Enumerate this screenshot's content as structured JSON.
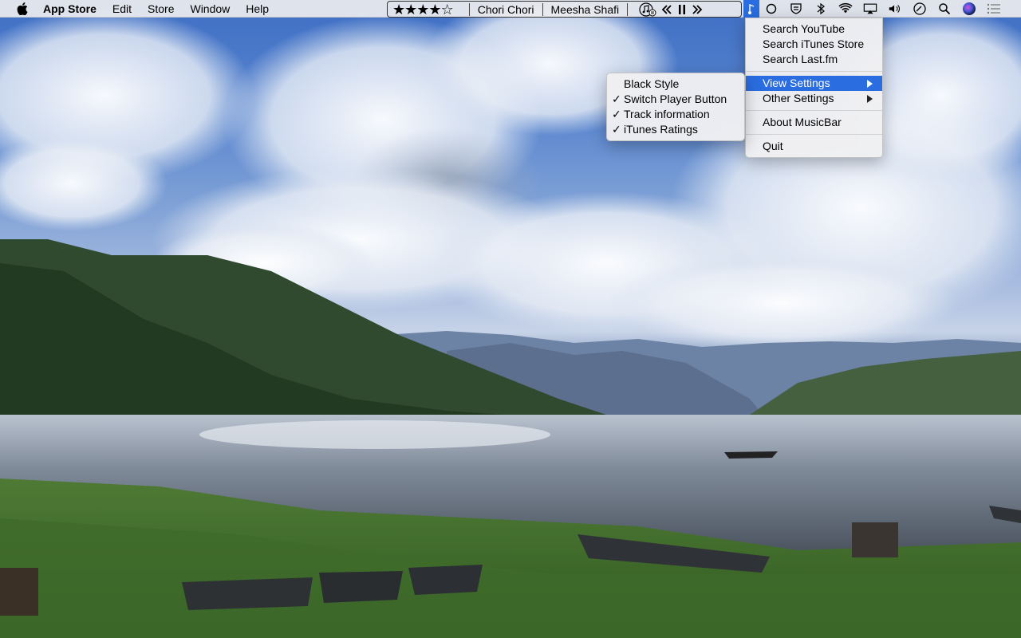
{
  "menubar": {
    "app_name": "App Store",
    "menus": [
      "Edit",
      "Store",
      "Window",
      "Help"
    ],
    "player": {
      "rating": 4,
      "rating_max": 5,
      "track_title": "Chori Chori",
      "artist": "Meesha Shafi"
    }
  },
  "main_menu": {
    "group1": [
      "Search YouTube",
      "Search iTunes Store",
      "Search Last.fm"
    ],
    "view_settings": "View Settings",
    "other_settings": "Other Settings",
    "about": "About MusicBar",
    "quit": "Quit"
  },
  "view_settings_menu": {
    "items": [
      {
        "label": "Black Style",
        "checked": false
      },
      {
        "label": "Switch Player Button",
        "checked": true
      },
      {
        "label": "Track information",
        "checked": true
      },
      {
        "label": "iTunes Ratings",
        "checked": true
      }
    ],
    "check_glyph": "✓"
  },
  "icons": {
    "apple": "apple-icon",
    "status": [
      "circle-icon",
      "shield-icon",
      "bluetooth-icon",
      "wifi-icon",
      "airplay-icon",
      "volume-icon",
      "clock-icon",
      "search-icon",
      "siri-icon",
      "notification-list-icon"
    ]
  },
  "colors": {
    "highlight": "#2a6de0",
    "menubar": "#ececee"
  }
}
